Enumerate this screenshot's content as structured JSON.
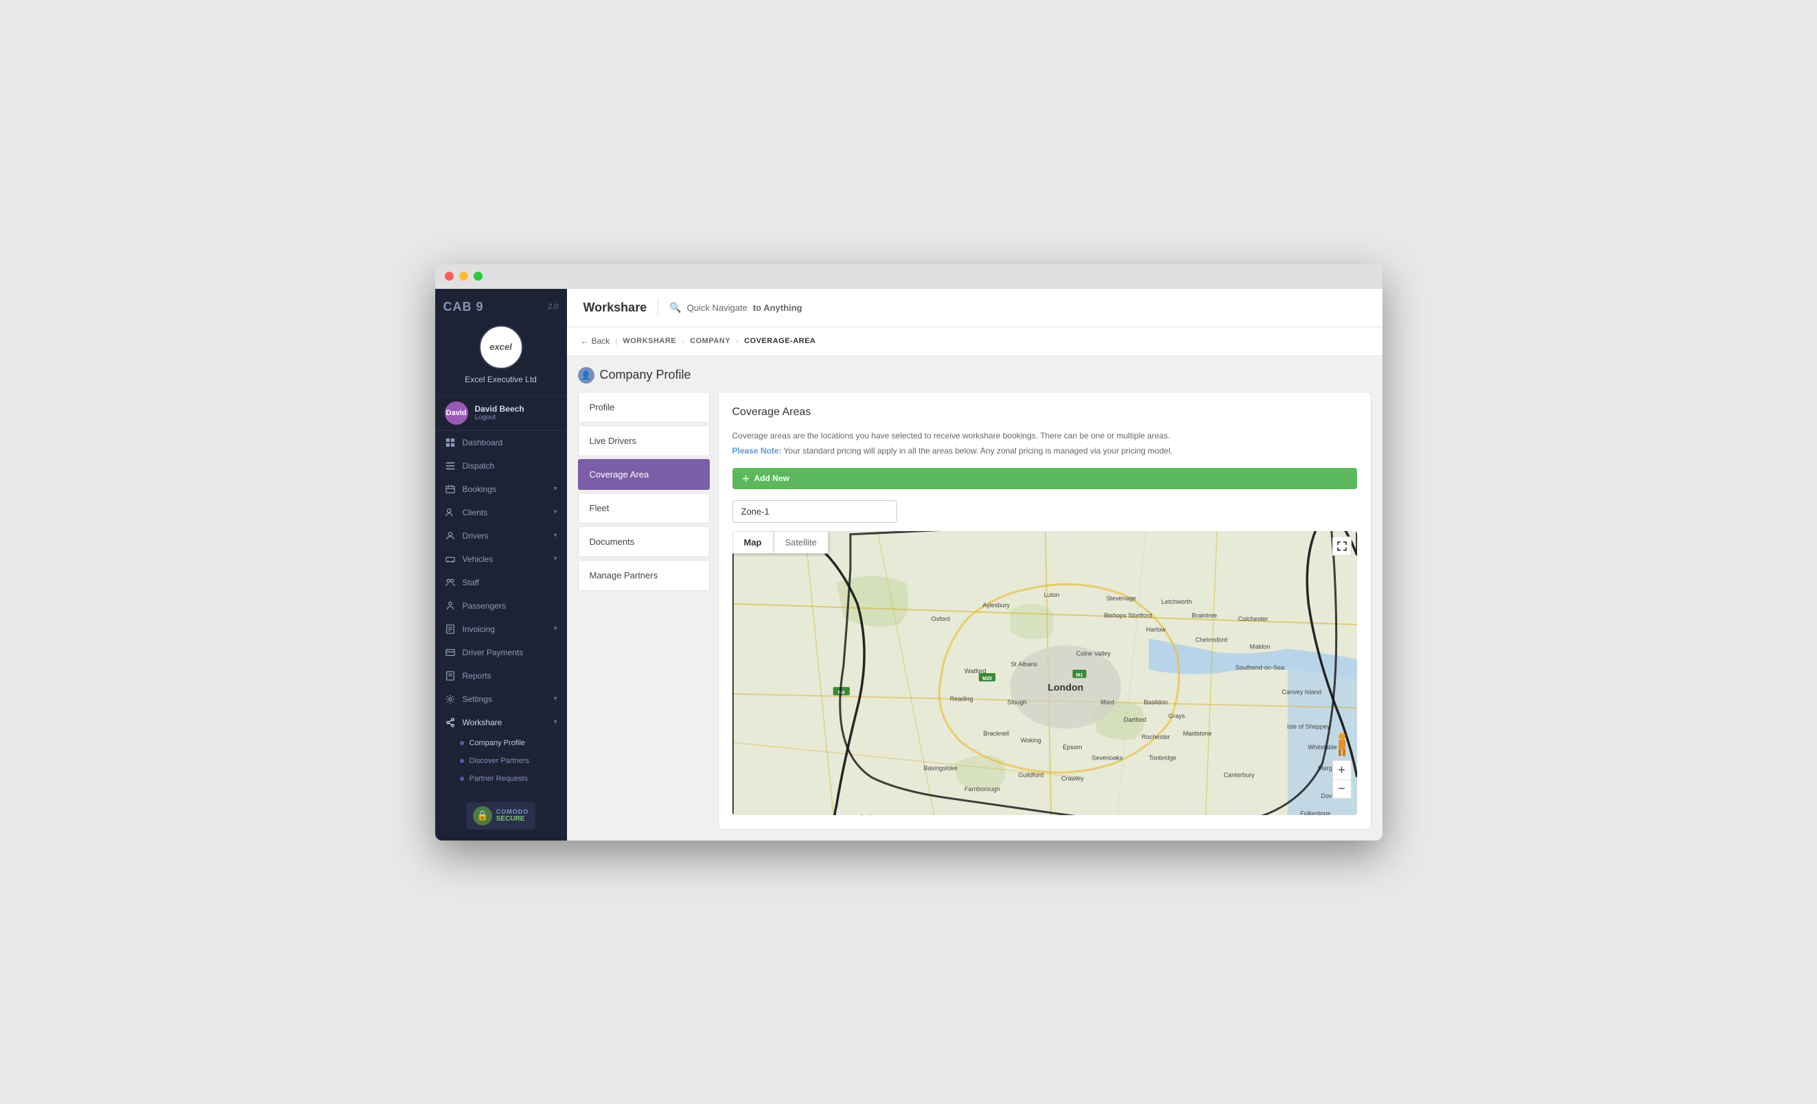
{
  "window": {
    "title": "Workshare"
  },
  "sidebar": {
    "brand": "CAB 9",
    "version": "2.0",
    "logo_text": "excel",
    "company_name": "Excel Executive Ltd",
    "user": {
      "name": "David Beech",
      "initials": "David",
      "logout_label": "Logout"
    },
    "nav_items": [
      {
        "id": "dashboard",
        "label": "Dashboard",
        "icon": "grid"
      },
      {
        "id": "dispatch",
        "label": "Dispatch",
        "icon": "map"
      },
      {
        "id": "bookings",
        "label": "Bookings",
        "icon": "calendar",
        "has_arrow": true
      },
      {
        "id": "clients",
        "label": "Clients",
        "icon": "users",
        "has_arrow": true
      },
      {
        "id": "drivers",
        "label": "Drivers",
        "icon": "person",
        "has_arrow": true
      },
      {
        "id": "vehicles",
        "label": "Vehicles",
        "icon": "car",
        "has_arrow": true
      },
      {
        "id": "staff",
        "label": "Staff",
        "icon": "people"
      },
      {
        "id": "passengers",
        "label": "Passengers",
        "icon": "group"
      },
      {
        "id": "invoicing",
        "label": "Invoicing",
        "icon": "invoice",
        "has_arrow": true
      },
      {
        "id": "driver-payments",
        "label": "Driver Payments",
        "icon": "payment"
      },
      {
        "id": "reports",
        "label": "Reports",
        "icon": "report"
      },
      {
        "id": "settings",
        "label": "Settings",
        "icon": "settings",
        "has_arrow": true
      },
      {
        "id": "workshare",
        "label": "Workshare",
        "icon": "share",
        "has_arrow": true,
        "active": true
      }
    ],
    "workshare_sub": [
      {
        "id": "company-profile",
        "label": "Company Profile",
        "active": true
      },
      {
        "id": "discover-partners",
        "label": "Discover Partners"
      },
      {
        "id": "partner-requests",
        "label": "Partner Requests"
      }
    ],
    "comodo": {
      "name": "COMODO",
      "secure": "SECURE"
    }
  },
  "topbar": {
    "title": "Workshare",
    "search_placeholder": "Quick Navigate to Anything",
    "search_quick": "Quick Navigate ",
    "search_bold": "to Anything"
  },
  "breadcrumb": {
    "back_label": "Back",
    "items": [
      "WORKSHARE",
      "COMPANY",
      "COVERAGE-AREA"
    ]
  },
  "page": {
    "header_icon": "person",
    "title": "Company Profile"
  },
  "left_panel": {
    "items": [
      {
        "id": "profile",
        "label": "Profile"
      },
      {
        "id": "live-drivers",
        "label": "Live Drivers"
      },
      {
        "id": "coverage-area",
        "label": "Coverage Area",
        "active": true
      },
      {
        "id": "fleet",
        "label": "Fleet"
      },
      {
        "id": "documents",
        "label": "Documents"
      },
      {
        "id": "manage-partners",
        "label": "Manage Partners"
      }
    ]
  },
  "coverage": {
    "title": "Coverage Areas",
    "description": "Coverage areas are the locations you have selected to receive workshare bookings. There can be one or multiple areas.",
    "note_label": "Please Note:",
    "note_text": " Your standard pricing will apply in all the areas below. Any zonal pricing is managed via your pricing model.",
    "add_new_label": "Add New",
    "zone_name": "Zone-1",
    "map_tab_map": "Map",
    "map_tab_satellite": "Satellite"
  }
}
